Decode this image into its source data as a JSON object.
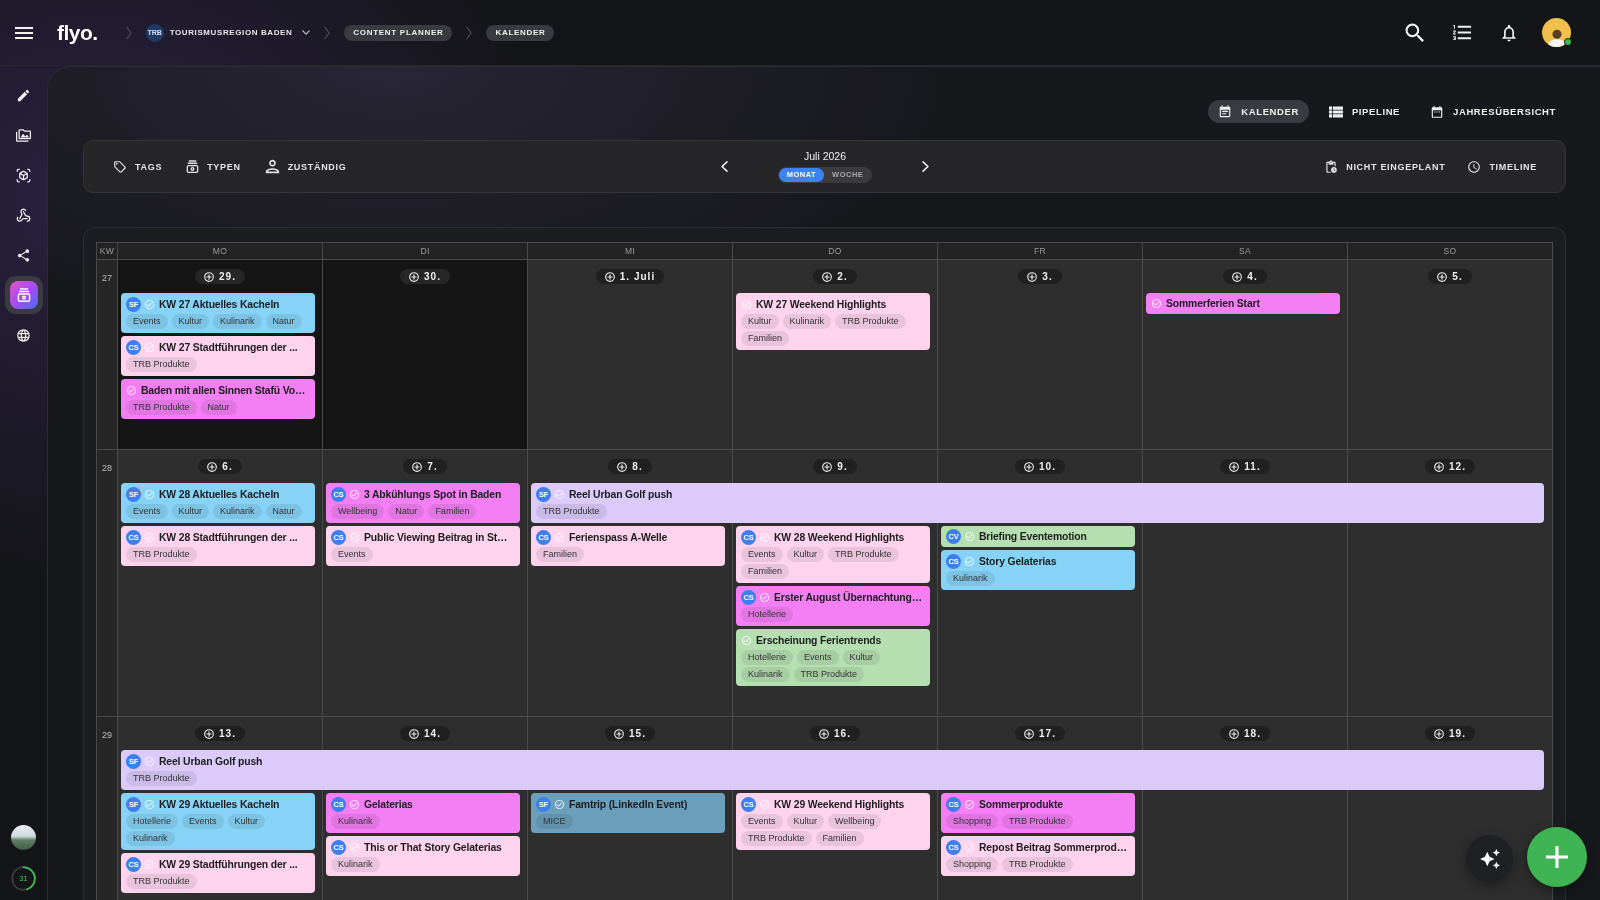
{
  "top_bar": {
    "logo": "flyo.",
    "breadcrumbs": [
      {
        "kind": "workspace",
        "badge": "TRB",
        "label": "TOURISMUSREGION BADEN"
      },
      {
        "kind": "chip",
        "label": "CONTENT PLANNER"
      },
      {
        "kind": "chip",
        "label": "KALENDER"
      }
    ],
    "user": {
      "online": true
    }
  },
  "sidebar": {
    "items": [
      {
        "selected": false
      },
      {
        "selected": false
      },
      {
        "selected": false
      },
      {
        "selected": false
      },
      {
        "selected": false
      },
      {
        "selected": true
      },
      {
        "selected": false
      }
    ],
    "usage": {
      "reading": "31",
      "level": 0.45
    }
  },
  "views": [
    {
      "label": "KALENDER",
      "selected": true
    },
    {
      "label": "PIPELINE",
      "selected": false
    },
    {
      "label": "JAHRESÜBERSICHT",
      "selected": false
    }
  ],
  "toolbar": {
    "filters": [
      "TAGS",
      "TYPEN",
      "ZUSTÄNDIG"
    ],
    "period": "Juli 2026",
    "modes": [
      {
        "label": "MONAT",
        "selected": true
      },
      {
        "label": "WOCHE",
        "selected": false
      }
    ],
    "actions": [
      "NICHT EINGEPLANT",
      "TIMELINE"
    ]
  },
  "calendar": {
    "week_label": "KW",
    "weekdays": [
      "MO",
      "DI",
      "MI",
      "DO",
      "FR",
      "SA",
      "SO"
    ],
    "weeks": [
      {
        "kw": "27",
        "days": [
          {
            "date": "29.",
            "muted": true,
            "events": [
              {
                "kind": "single",
                "title": "KW 27 Aktuelles Kacheln",
                "color": "#86d3f7",
                "owner": "SF",
                "tags": [
                  "Events",
                  "Kultur",
                  "Kulinarik",
                  "Natur"
                ]
              },
              {
                "kind": "single",
                "title": "KW 27 Stadtführungen der ...",
                "color": "#fdd3ee",
                "owner": "CS",
                "tags": [
                  "TRB Produkte"
                ]
              },
              {
                "kind": "single",
                "title": "Baden mit allen Sinnen Stafü Vo…",
                "color": "#f47ef3",
                "tags": [
                  "TRB Produkte",
                  "Natur"
                ]
              }
            ]
          },
          {
            "date": "30.",
            "muted": true
          },
          {
            "date": "1. Juli",
            "muted": false
          },
          {
            "date": "2.",
            "muted": false,
            "events": [
              {
                "kind": "single",
                "title": "KW 27 Weekend Highlights",
                "color": "#fdd3ee",
                "tags": [
                  "Kultur",
                  "Kulinarik",
                  "TRB Produkte",
                  "Familien"
                ]
              }
            ]
          },
          {
            "date": "3.",
            "muted": false
          },
          {
            "date": "4.",
            "muted": false,
            "events": [
              {
                "kind": "single",
                "title": "Sommerferien Start",
                "color": "#f47ef3"
              }
            ]
          },
          {
            "date": "5.",
            "muted": false
          }
        ]
      },
      {
        "kw": "28",
        "days": [
          {
            "date": "6.",
            "muted": false,
            "events": [
              {
                "kind": "single",
                "title": "KW 28 Aktuelles Kacheln",
                "color": "#86d3f7",
                "owner": "SF",
                "tags": [
                  "Events",
                  "Kultur",
                  "Kulinarik",
                  "Natur"
                ]
              },
              {
                "kind": "single",
                "title": "KW 28 Stadtführungen der ...",
                "color": "#fdd3ee",
                "owner": "CS",
                "tags": [
                  "TRB Produkte"
                ]
              }
            ]
          },
          {
            "date": "7.",
            "muted": false,
            "events": [
              {
                "kind": "single",
                "title": "3 Abkühlungs Spot in Baden",
                "color": "#f47ef3",
                "owner": "CS",
                "tags": [
                  "Wellbeing",
                  "Natur",
                  "Familien"
                ]
              },
              {
                "kind": "single",
                "title": "Public Viewing Beitrag in St…",
                "color": "#fdd3ee",
                "owner": "CS",
                "tags": [
                  "Events"
                ]
              }
            ]
          },
          {
            "date": "8.",
            "muted": false,
            "events": [
              {
                "kind": "multi_day",
                "title": "Reel Urban Golf push",
                "color": "#dccafb",
                "owner": "SF",
                "tags": [
                  "TRB Produkte"
                ]
              },
              {
                "kind": "single",
                "title": "Ferienspass A-Welle",
                "color": "#fdd3ee",
                "owner": "CS",
                "tags": [
                  "Familien"
                ]
              }
            ]
          },
          {
            "date": "9.",
            "muted": false,
            "events": [
              {
                "kind": "single",
                "title": "KW 28 Weekend Highlights",
                "color": "#fdd3ee",
                "owner": "CS",
                "tags": [
                  "Events",
                  "Kultur",
                  "TRB Produkte",
                  "Familien"
                ]
              },
              {
                "kind": "single",
                "title": "Erster August Übernachtung…",
                "color": "#f47ef3",
                "owner": "CS",
                "tags": [
                  "Hotellerie"
                ]
              },
              {
                "kind": "single",
                "title": "Erscheinung Ferientrends",
                "color": "#b6dfb1",
                "tags": [
                  "Hotellerie",
                  "Events",
                  "Kultur",
                  "Kulinarik",
                  "TRB Produkte"
                ]
              }
            ]
          },
          {
            "date": "10.",
            "muted": false,
            "events": [
              {
                "kind": "single",
                "title": "Briefing Eventemotion",
                "color": "#b6dfb1",
                "owner": "CV"
              },
              {
                "kind": "single",
                "title": "Story Gelaterias",
                "color": "#86d3f7",
                "owner": "CS",
                "tags": [
                  "Kulinarik"
                ]
              }
            ]
          },
          {
            "date": "11.",
            "muted": false
          },
          {
            "date": "12.",
            "muted": false
          }
        ]
      },
      {
        "kw": "29",
        "days": [
          {
            "date": "13.",
            "muted": false,
            "events": [
              {
                "kind": "multi_day",
                "title": "Reel Urban Golf push",
                "color": "#dccafb",
                "owner": "SF",
                "tags": [
                  "TRB Produkte"
                ]
              },
              {
                "kind": "single",
                "title": "KW 29 Aktuelles Kacheln",
                "color": "#86d3f7",
                "owner": "SF",
                "tags": [
                  "Hotellerie",
                  "Events",
                  "Kultur",
                  "Kulinarik"
                ]
              },
              {
                "kind": "single",
                "title": "KW 29 Stadtführungen der ...",
                "color": "#fdd3ee",
                "owner": "CS",
                "tags": [
                  "TRB Produkte"
                ]
              }
            ]
          },
          {
            "date": "14.",
            "muted": false,
            "events": [
              {
                "kind": "single",
                "title": "Gelaterias",
                "color": "#f47ef3",
                "owner": "CS",
                "tags": [
                  "Kulinarik"
                ]
              },
              {
                "kind": "single",
                "title": "This or That Story Gelaterias",
                "color": "#fdd3ee",
                "owner": "CS",
                "tags": [
                  "Kulinarik"
                ]
              }
            ]
          },
          {
            "date": "15.",
            "muted": false,
            "events": [
              {
                "kind": "single",
                "title": "Famtrip (LinkedIn Event)",
                "color": "#6b9fba",
                "owner": "SF",
                "tags": [
                  "MICE"
                ]
              }
            ]
          },
          {
            "date": "16.",
            "muted": false,
            "events": [
              {
                "kind": "single",
                "title": "KW 29 Weekend Highlights",
                "color": "#fdd3ee",
                "owner": "CS",
                "tags": [
                  "Events",
                  "Kultur",
                  "Wellbeing",
                  "TRB Produkte",
                  "Familien"
                ]
              }
            ]
          },
          {
            "date": "17.",
            "muted": false,
            "events": [
              {
                "kind": "single",
                "title": "Sommerprodukte",
                "color": "#f47ef3",
                "owner": "CS",
                "tags": [
                  "Shopping",
                  "TRB Produkte"
                ]
              },
              {
                "kind": "single",
                "title": "Repost Beitrag Sommerprod…",
                "color": "#fdd3ee",
                "owner": "CS",
                "tags": [
                  "Shopping",
                  "TRB Produkte"
                ]
              }
            ]
          },
          {
            "date": "18.",
            "muted": false
          },
          {
            "date": "19.",
            "muted": false
          }
        ]
      }
    ]
  }
}
